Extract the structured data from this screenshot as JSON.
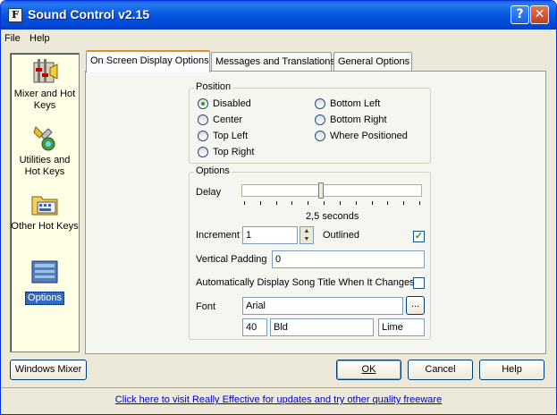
{
  "window": {
    "title": "Sound Control v2.15",
    "help_glyph": "?",
    "close_glyph": "✕",
    "app_icon_glyph": "F"
  },
  "menu": [
    "File",
    "Help"
  ],
  "sidebar": {
    "items": [
      {
        "label": "Mixer and Hot Keys",
        "icon": "mixer-icon",
        "selected": false
      },
      {
        "label": "Utilities and Hot Keys",
        "icon": "utilities-icon",
        "selected": false
      },
      {
        "label": "Other Hot Keys",
        "icon": "folder-keys-icon",
        "selected": false
      },
      {
        "label": "Options",
        "icon": "options-icon",
        "selected": true
      }
    ],
    "windows_mixer_button": "Windows Mixer"
  },
  "tabs": [
    {
      "label": "On Screen Display Options",
      "active": true
    },
    {
      "label": "Messages and Translations",
      "active": false
    },
    {
      "label": "General Options",
      "active": false
    }
  ],
  "position_group": {
    "legend": "Position",
    "options": [
      {
        "label": "Disabled",
        "checked": true
      },
      {
        "label": "Center",
        "checked": false
      },
      {
        "label": "Top Left",
        "checked": false
      },
      {
        "label": "Top Right",
        "checked": false
      },
      {
        "label": "Bottom Left",
        "checked": false
      },
      {
        "label": "Bottom Right",
        "checked": false
      },
      {
        "label": "Where Positioned",
        "checked": false
      }
    ]
  },
  "options_group": {
    "legend": "Options",
    "delay_label": "Delay",
    "delay_value_text": "2,5 seconds",
    "delay_fraction": 0.44,
    "increment_label": "Increment",
    "increment_value": "1",
    "outlined_label": "Outlined",
    "outlined_checked": true,
    "vertical_padding_label": "Vertical Padding",
    "vertical_padding_value": "0",
    "auto_display_label": "Automatically Display Song Title When It Changes",
    "auto_display_checked": false,
    "font_label": "Font",
    "font_name": "Arial",
    "font_browse_label": "...",
    "font_size": "40",
    "font_style": "Bld",
    "font_color": "Lime"
  },
  "buttons": {
    "ok": "OK",
    "cancel": "Cancel",
    "help": "Help"
  },
  "footer": {
    "link_text": "Click here to visit Really Effective for updates and try other quality freeware"
  },
  "colors": {
    "titlebar": "#0556de",
    "selection": "#316ac5",
    "tab_highlight": "#e68b2c",
    "link": "#0000cc"
  }
}
